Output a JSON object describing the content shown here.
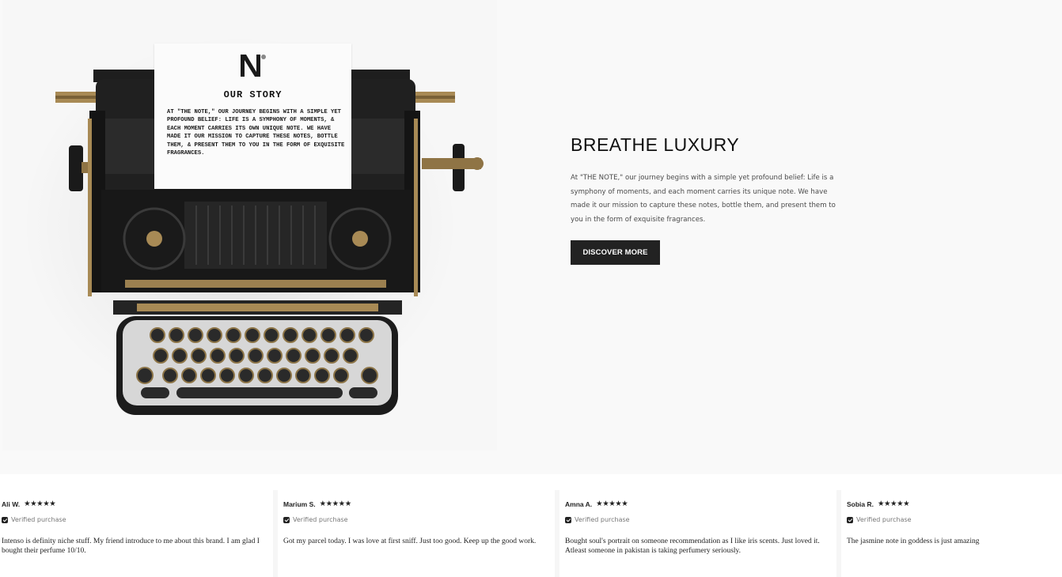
{
  "hero": {
    "paper": {
      "title": "OUR STORY",
      "text": "AT \"THE NOTE,\" OUR JOURNEY BEGINS WITH A SIMPLE YET PROFOUND BELIEF: LIFE IS A SYMPHONY OF MOMENTS, & EACH MOMENT CARRIES ITS OWN UNIQUE NOTE. WE HAVE MADE IT OUR MISSION TO CAPTURE THESE NOTES, BOTTLE THEM, & PRESENT THEM TO YOU IN THE FORM OF EXQUISITE FRAGRANCES."
    },
    "heading": "BREATHE LUXURY",
    "body": "At \"THE NOTE,\" our journey begins with a simple yet profound belief: Life is a symphony of moments, and each moment carries its unique note. We have made it our mission to capture these notes, bottle them, and present them to you in the form of exquisite fragrances.",
    "button_label": "DISCOVER MORE"
  },
  "reviews": [
    {
      "name": "Ali W.",
      "stars": "★★★★★",
      "verified": "Verified purchase",
      "text": "Intenso is definity niche stuff. My friend introduce to me about this brand. I am glad I bought their perfume 10/10."
    },
    {
      "name": "Marium S.",
      "stars": "★★★★★",
      "verified": "Verified purchase",
      "text": "Got my parcel today. I was love at first sniff. Just too good. Keep up the good work."
    },
    {
      "name": "Amna A.",
      "stars": "★★★★★",
      "verified": "Verified purchase",
      "text": "Bought soul's portrait on someone recommendation as I like iris scents. Just loved it. Atleast someone in pakistan is taking perfumery seriously."
    },
    {
      "name": "Sobia R.",
      "stars": "★★★★★",
      "verified": "Verified purchase",
      "text": "The jasmine note in goddess is just amazing"
    }
  ],
  "colors": {
    "accent": "#222222",
    "hero_bg": "#f9f9f9",
    "brass": "#9c8050"
  },
  "icons": [
    "note-logo-icon",
    "star-icon",
    "verified-check-icon"
  ]
}
